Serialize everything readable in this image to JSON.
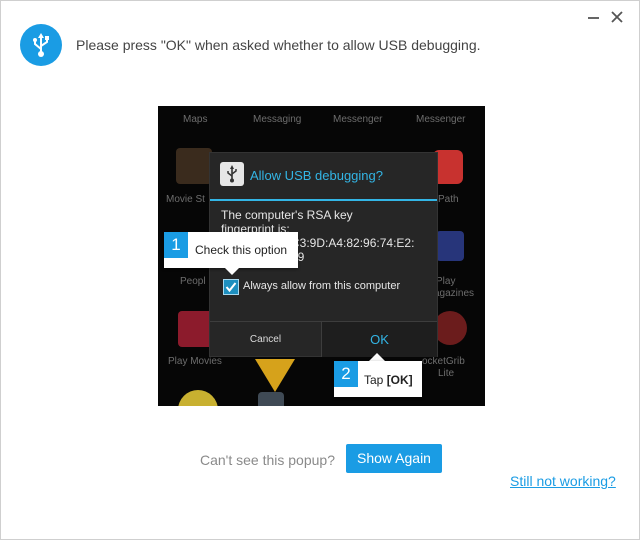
{
  "header": {
    "icon": "usb-icon",
    "text": "Please press \"OK\" when asked whether to allow USB debugging."
  },
  "window_controls": {
    "minimize": "minimize-icon",
    "close": "close-icon"
  },
  "phone": {
    "app_labels": {
      "row1": [
        "Maps",
        "Messaging",
        "Messenger",
        "Messenger"
      ],
      "movie": "Movie St",
      "path": "Path",
      "people": "Peopl",
      "play": "Play",
      "magazines": "agazines",
      "play_movies": "Play Movies",
      "pocketgrib1": "ocketGrib",
      "pocketgrib2": "Lite"
    },
    "dialog": {
      "title": "Allow USB debugging?",
      "body_line1": "The computer's RSA key",
      "body_line2": "fingerprint is:",
      "body_line3": "C3:9D:A4:82:96:74:E2:",
      "body_line4": "39",
      "checkbox_label": "Always allow from this computer",
      "checkbox_checked": true,
      "cancel_label": "Cancel",
      "ok_label": "OK"
    }
  },
  "callouts": [
    {
      "number": "1",
      "text": "Check this option"
    },
    {
      "number": "2",
      "text_prefix": "Tap ",
      "text_bold": "[OK]"
    }
  ],
  "footer": {
    "question": "Can't see this popup?",
    "show_again_label": "Show Again",
    "still_not_working_label": "Still not working?"
  },
  "colors": {
    "accent": "#1a9ce4",
    "android_blue": "#33b5e5"
  }
}
